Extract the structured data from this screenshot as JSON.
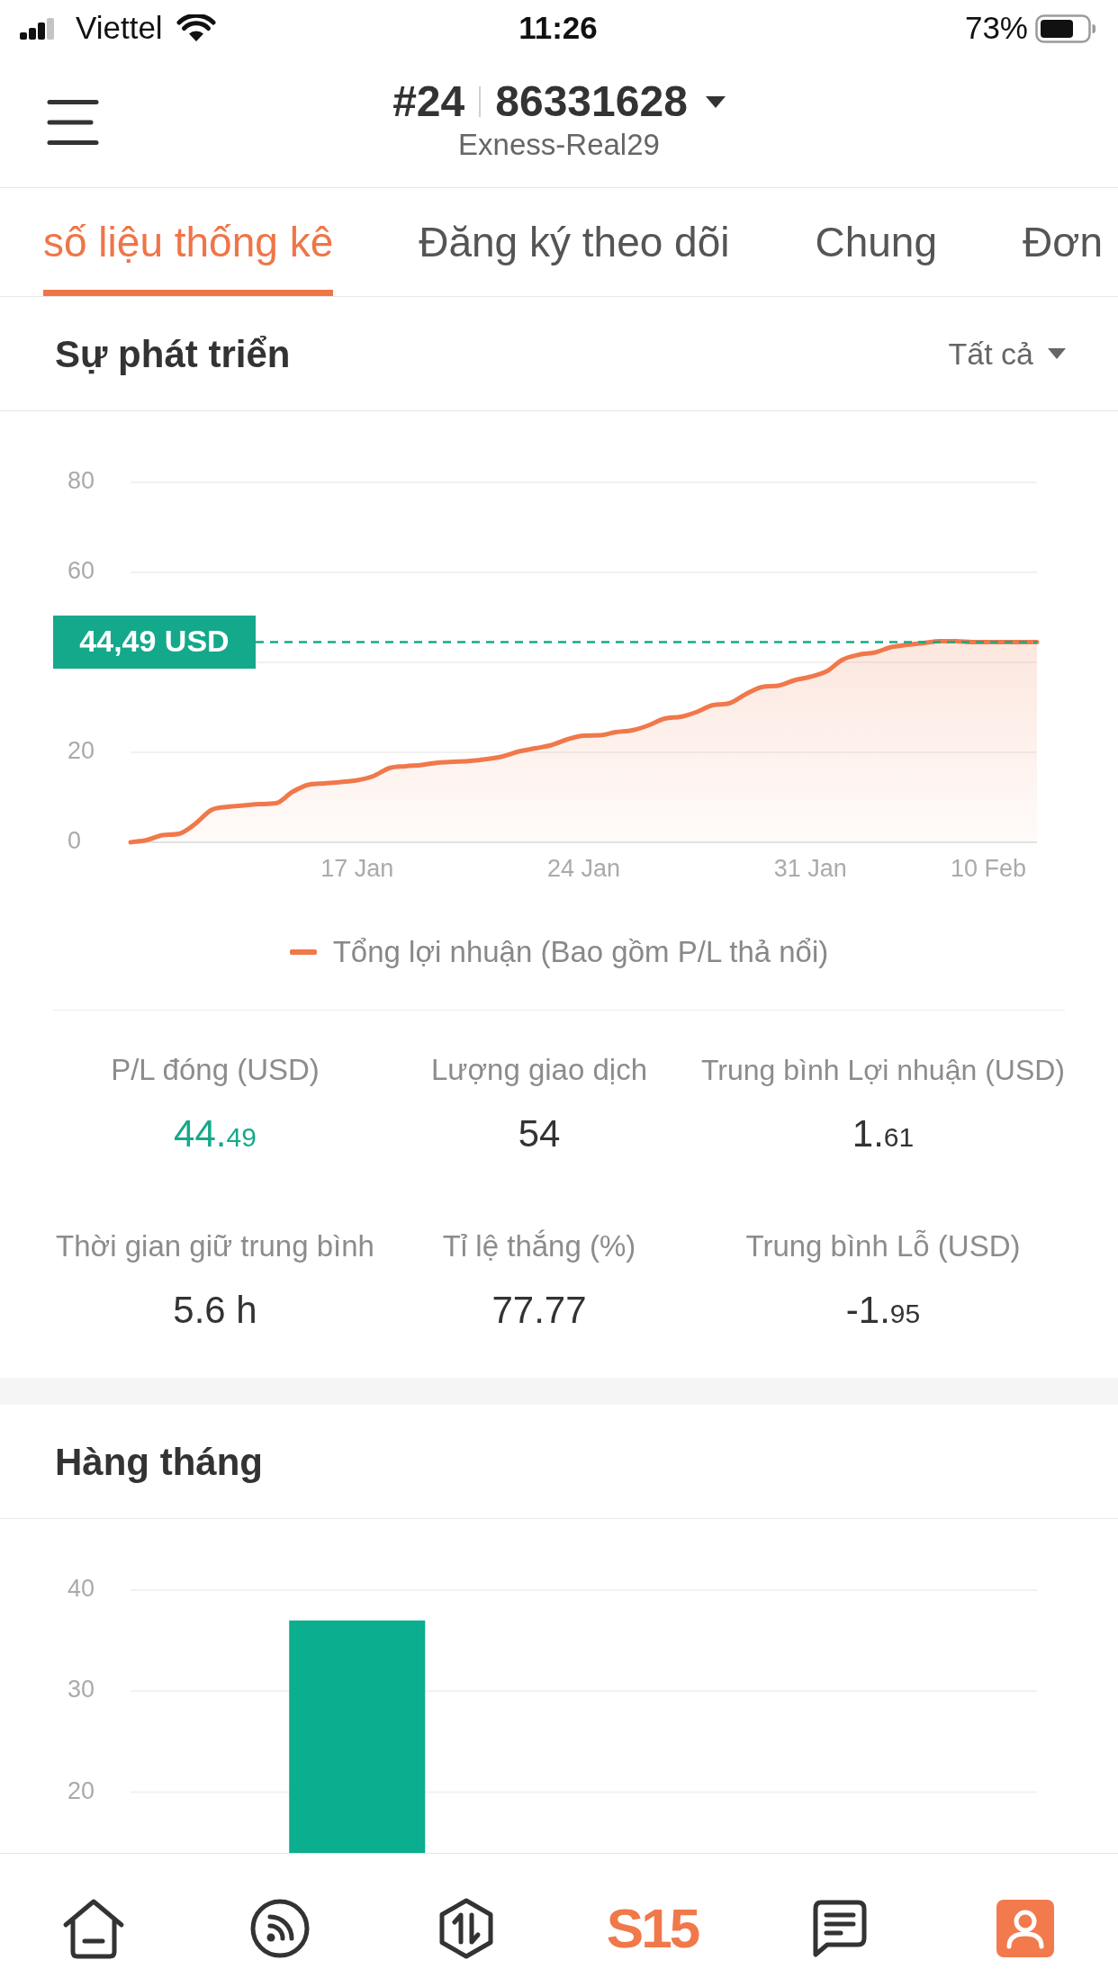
{
  "status_bar": {
    "carrier": "Viettel",
    "time": "11:26",
    "battery": "73%"
  },
  "header": {
    "account_number": "#24",
    "account_id": "86331628",
    "server": "Exness-Real29"
  },
  "tabs": [
    {
      "label": "số liệu thống kê",
      "selected": true
    },
    {
      "label": "Đăng ký theo dõi",
      "selected": false
    },
    {
      "label": "Chung",
      "selected": false
    },
    {
      "label": "Đơn",
      "selected": false
    }
  ],
  "growth": {
    "title": "Sự phát triển",
    "filter": "Tất cả",
    "chart_data": {
      "type": "line",
      "categories": [
        null,
        null,
        null,
        null,
        null,
        null,
        null,
        null,
        null,
        null,
        null,
        null,
        null,
        null,
        "17 Jan",
        null,
        null,
        null,
        null,
        null,
        null,
        null,
        null,
        null,
        null,
        null,
        null,
        null,
        "24 Jan",
        null,
        null,
        null,
        null,
        null,
        null,
        null,
        null,
        null,
        null,
        null,
        null,
        null,
        "31 Jan",
        null,
        null,
        null,
        null,
        null,
        null,
        null,
        null,
        null,
        null,
        "10 Feb",
        null,
        null,
        null
      ],
      "series": [
        {
          "name": "Tổng lợi nhuận (Bao gồm P/L thả nổi)",
          "color": "#f0784a",
          "values": [
            0,
            0.5,
            1.6,
            1.9,
            4.1,
            7.2,
            7.9,
            8.2,
            8.5,
            8.7,
            11.2,
            12.8,
            13.1,
            13.4,
            13.8,
            14.7,
            16.5,
            16.9,
            17.2,
            17.7,
            17.9,
            18.1,
            18.5,
            19.1,
            20.2,
            20.9,
            21.6,
            22.9,
            23.7,
            23.8,
            24.5,
            24.9,
            26.0,
            27.5,
            27.9,
            29.0,
            30.5,
            30.9,
            32.9,
            34.5,
            34.8,
            36.0,
            36.8,
            38.0,
            40.6,
            41.7,
            42.2,
            43.4,
            43.9,
            44.3,
            44.7,
            44.7,
            44.5,
            44.5,
            44.5,
            44.5,
            44.5
          ]
        }
      ],
      "ylim": [
        0,
        80
      ],
      "yticks": [
        0,
        20,
        60,
        80
      ],
      "grid": true,
      "ref_lines": [
        {
          "axis": "y",
          "value": 44.49,
          "label": "44,49 USD"
        }
      ]
    },
    "stats": [
      {
        "label": "P/L đóng (USD)",
        "value": "44.49",
        "accent": true,
        "small_decimals": true
      },
      {
        "label": "Lượng giao dịch",
        "value": "54",
        "accent": false
      },
      {
        "label": "Trung bình Lợi nhuận (USD)",
        "value": "1.61",
        "accent": false,
        "small_decimals": true
      },
      {
        "label": "Thời gian giữ trung bình",
        "value": "5.6 h",
        "accent": false,
        "small_decimals": false
      },
      {
        "label": "Tỉ lệ thắng (%)",
        "value": "77.77",
        "accent": false,
        "small_decimals": false
      },
      {
        "label": "Trung bình Lỗ (USD)",
        "value": "-1.95",
        "accent": false,
        "small_decimals": true
      }
    ]
  },
  "monthly": {
    "title": "Hàng tháng",
    "chart_data": {
      "type": "bar",
      "values": [
        37,
        null
      ],
      "ylim": [
        14,
        40
      ],
      "yticks": [
        20,
        30,
        40
      ],
      "grid": true
    }
  },
  "bottom_nav": {
    "logo": "S15"
  }
}
